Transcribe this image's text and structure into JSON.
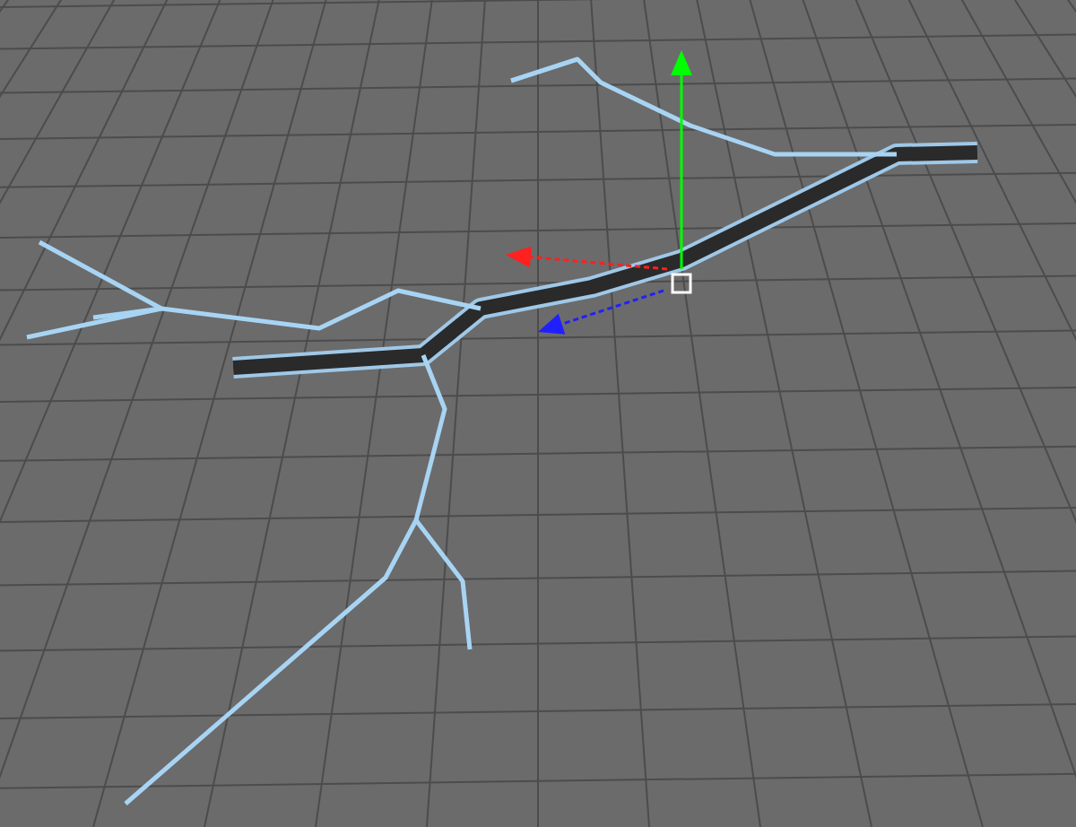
{
  "viewport": {
    "gizmo_axes": [
      {
        "color": "#00ff00"
      },
      {
        "color": "#ff2020"
      },
      {
        "color": "#2020ff"
      }
    ]
  }
}
